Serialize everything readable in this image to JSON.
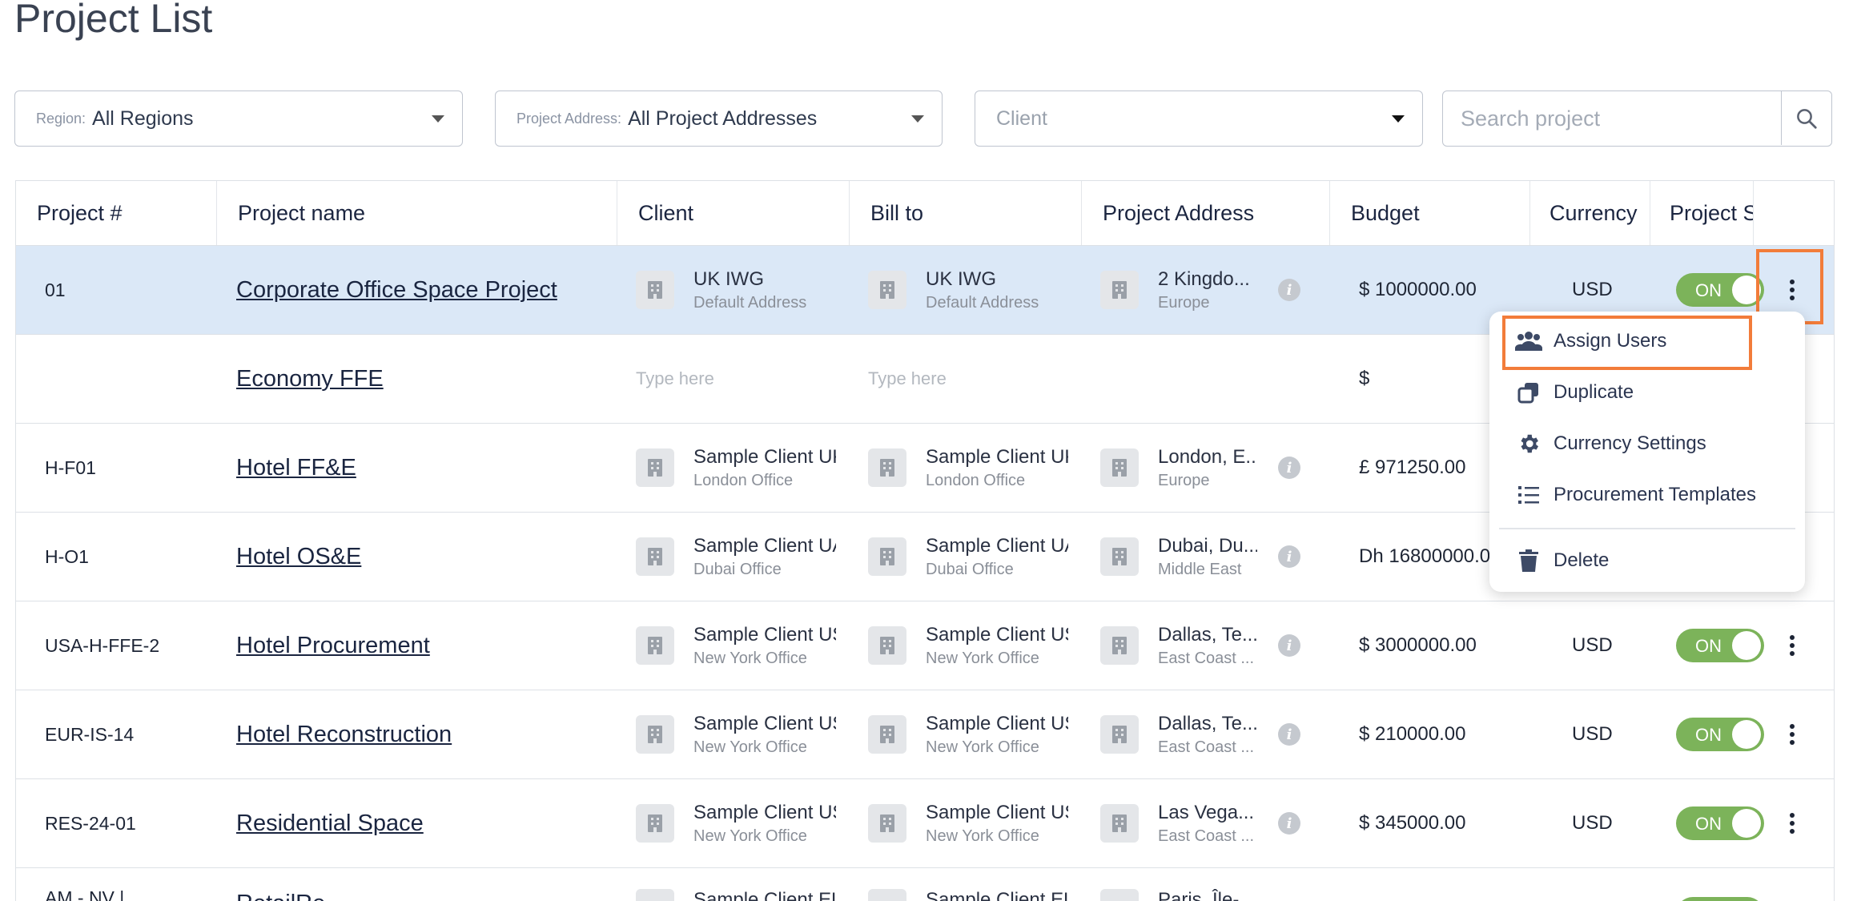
{
  "page": {
    "title": "Project List"
  },
  "filters": {
    "region": {
      "label": "Region:",
      "value": "All Regions"
    },
    "address": {
      "label": "Project Address:",
      "value": "All Project Addresses"
    },
    "client": {
      "placeholder": "Client"
    },
    "search": {
      "placeholder": "Search project"
    }
  },
  "table": {
    "headers": [
      "Project #",
      "Project name",
      "Client",
      "Bill to",
      "Project Address",
      "Budget",
      "Currency",
      "Project S"
    ],
    "rows": [
      {
        "number": "01",
        "name": "Corporate Office Space Project",
        "client": {
          "name": "UK IWG",
          "sub": "Default Address"
        },
        "bill_to": {
          "name": "UK IWG",
          "sub": "Default Address"
        },
        "address": {
          "main": "2 Kingdo...",
          "sub": "Europe"
        },
        "budget": "$ 1000000.00",
        "currency": "USD",
        "status": "ON"
      },
      {
        "number": "",
        "name": "Economy FFE",
        "client_placeholder": "Type here",
        "bill_to_placeholder": "Type here",
        "budget": "$"
      },
      {
        "number": "H-F01",
        "name": "Hotel FF&E",
        "client": {
          "name": "Sample Client UK",
          "sub": "London Office"
        },
        "bill_to": {
          "name": "Sample Client UK",
          "sub": "London Office"
        },
        "address": {
          "main": "London, E...",
          "sub": "Europe"
        },
        "budget": "£ 971250.00"
      },
      {
        "number": "H-O1",
        "name": "Hotel OS&E",
        "client": {
          "name": "Sample Client UAE",
          "sub": "Dubai Office"
        },
        "bill_to": {
          "name": "Sample Client UAE",
          "sub": "Dubai Office"
        },
        "address": {
          "main": "Dubai, Du...",
          "sub": "Middle East"
        },
        "budget": "Dh 16800000.0"
      },
      {
        "number": "USA-H-FFE-2",
        "name": "Hotel Procurement",
        "client": {
          "name": "Sample Client US",
          "sub": "New York Office"
        },
        "bill_to": {
          "name": "Sample Client US",
          "sub": "New York Office"
        },
        "address": {
          "main": "Dallas, Te...",
          "sub": "East Coast ..."
        },
        "budget": "$ 3000000.00",
        "currency": "USD",
        "status": "ON"
      },
      {
        "number": "EUR-IS-14",
        "name": "Hotel Reconstruction",
        "client": {
          "name": "Sample Client US",
          "sub": "New York Office"
        },
        "bill_to": {
          "name": "Sample Client US",
          "sub": "New York Office"
        },
        "address": {
          "main": "Dallas, Te...",
          "sub": "East Coast ..."
        },
        "budget": "$ 210000.00",
        "currency": "USD",
        "status": "ON"
      },
      {
        "number": "RES-24-01",
        "name": "Residential Space",
        "client": {
          "name": "Sample Client US",
          "sub": "New York Office"
        },
        "bill_to": {
          "name": "Sample Client US",
          "sub": "New York Office"
        },
        "address": {
          "main": "Las Vega...",
          "sub": "East Coast ..."
        },
        "budget": "$ 345000.00",
        "currency": "USD",
        "status": "ON"
      },
      {
        "number": "AM - NV |",
        "name": "RetailRe...",
        "client": {
          "name": "Sample Client EU"
        },
        "bill_to": {
          "name": "Sample Client EU"
        },
        "address": {
          "main": "Paris, Île-"
        }
      }
    ]
  },
  "context_menu": {
    "items": [
      {
        "label": "Assign Users",
        "icon": "users-icon"
      },
      {
        "label": "Duplicate",
        "icon": "duplicate-icon"
      },
      {
        "label": "Currency Settings",
        "icon": "gear-icon"
      },
      {
        "label": "Procurement Templates",
        "icon": "list-icon"
      },
      {
        "label": "Delete",
        "icon": "trash-icon"
      }
    ]
  },
  "colors": {
    "accent_highlight": "#f27c3a",
    "toggle_on": "#7cb35a",
    "selected_row": "#dbe8f7",
    "icon": "#3d4a66"
  }
}
